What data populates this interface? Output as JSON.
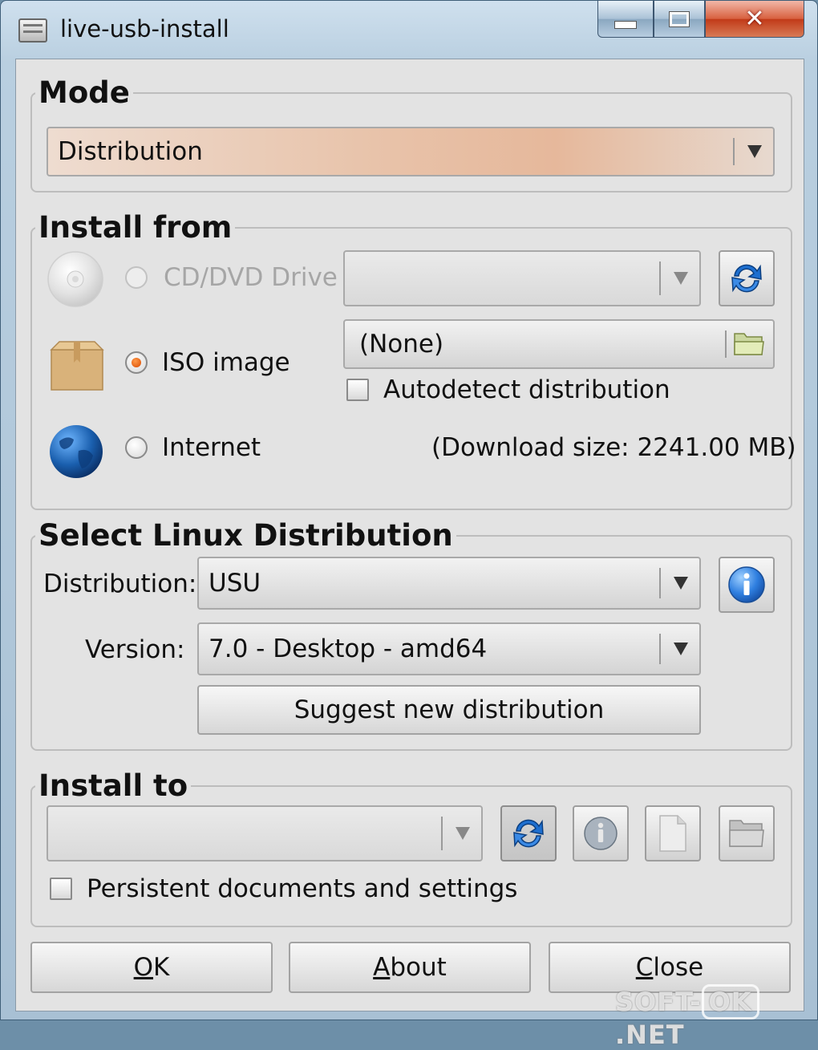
{
  "window": {
    "title": "live-usb-install"
  },
  "mode": {
    "legend": "Mode",
    "selected": "Distribution"
  },
  "install_from": {
    "legend": "Install from",
    "cd_label": "CD/DVD Drive",
    "cd_selected": "",
    "iso_label": "ISO image",
    "iso_selected": "(None)",
    "autodetect_label": "Autodetect distribution",
    "internet_label": "Internet",
    "download_size": "(Download size: 2241.00 MB)"
  },
  "select_distro": {
    "legend": "Select Linux Distribution",
    "distribution_label": "Distribution:",
    "distribution_value": "USU",
    "version_label": "Version:",
    "version_value": "7.0 - Desktop - amd64",
    "suggest_button": "Suggest new distribution"
  },
  "install_to": {
    "legend": "Install to",
    "device_selected": "",
    "persistent_label": "Persistent documents and settings"
  },
  "buttons": {
    "ok_mnemonic": "O",
    "ok_rest": "K",
    "about_mnemonic": "A",
    "about_rest": "bout",
    "close_mnemonic": "C",
    "close_rest": "lose"
  },
  "watermark": {
    "prefix": "SOFT-",
    "boxed": "OK",
    "suffix": ".NET"
  },
  "icons": {
    "app": "drive-icon",
    "cd": "cd-disc-icon",
    "iso": "package-box-icon",
    "internet": "globe-icon",
    "refresh": "refresh-icon",
    "folder": "folder-open-icon",
    "info": "info-icon",
    "document": "document-icon"
  },
  "colors": {
    "radio_checked": "#e0620a",
    "refresh_blue": "#1d6fd0",
    "info_blue": "#2f7fe0"
  }
}
